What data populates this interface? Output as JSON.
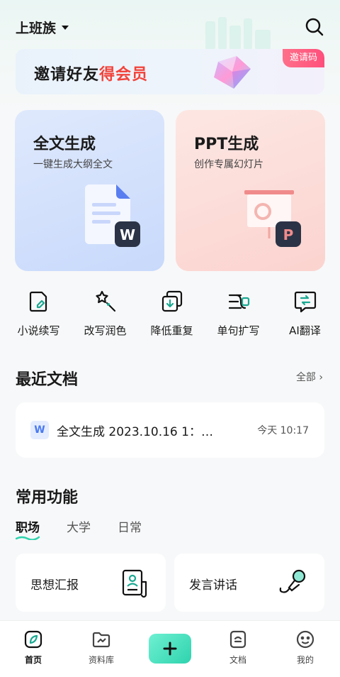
{
  "header": {
    "profile": "上班族"
  },
  "banner": {
    "text_a": "邀请好友",
    "text_b": "得会员",
    "badge": "邀请码"
  },
  "cards": [
    {
      "title": "全文生成",
      "subtitle": "一键生成大纲全文",
      "app_letter": "W"
    },
    {
      "title": "PPT生成",
      "subtitle": "创作专属幻灯片",
      "app_letter": "P"
    }
  ],
  "tools": [
    {
      "label": "小说续写",
      "icon": "doc-pen-icon"
    },
    {
      "label": "改写润色",
      "icon": "magic-wand-icon"
    },
    {
      "label": "降低重复",
      "icon": "copy-down-icon"
    },
    {
      "label": "单句扩写",
      "icon": "expand-lines-icon"
    },
    {
      "label": "AI翻译",
      "icon": "translate-icon"
    }
  ],
  "recent": {
    "title": "最近文档",
    "more": "全部 ›",
    "items": [
      {
        "badge": "W",
        "name": "全文生成 2023.10.16 1：…",
        "time": "今天 10:17"
      }
    ]
  },
  "common": {
    "title": "常用功能",
    "tabs": [
      "职场",
      "大学",
      "日常"
    ],
    "active_tab": 0,
    "items": [
      {
        "label": "思想汇报",
        "icon": "report-person-icon"
      },
      {
        "label": "发言讲话",
        "icon": "microphone-icon"
      }
    ]
  },
  "tabbar": {
    "items": [
      {
        "label": "首页",
        "icon": "home-icon"
      },
      {
        "label": "资料库",
        "icon": "folder-icon"
      },
      {
        "label": "",
        "icon": "plus-icon"
      },
      {
        "label": "文档",
        "icon": "document-icon"
      },
      {
        "label": "我的",
        "icon": "face-icon"
      }
    ]
  },
  "colors": {
    "accent": "#2fd3ae",
    "red": "#f2433b",
    "badge": "#ff5a80"
  }
}
